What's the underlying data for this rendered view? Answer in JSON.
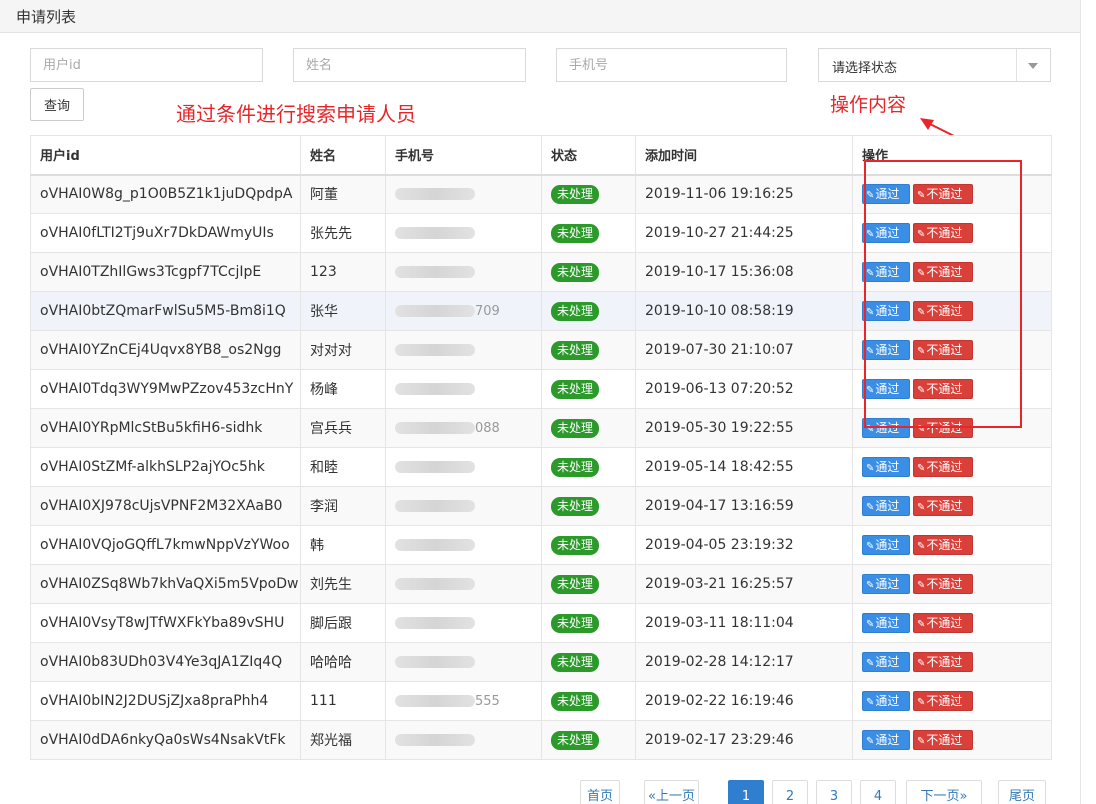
{
  "panel": {
    "title": "申请列表"
  },
  "filters": {
    "user_id_placeholder": "用户id",
    "name_placeholder": "姓名",
    "phone_placeholder": "手机号",
    "status_select_value": "请选择状态",
    "query_label": "查询"
  },
  "annotations": {
    "search_note": "通过条件进行搜索申请人员",
    "ops_note": "操作内容"
  },
  "table": {
    "headers": [
      "用户id",
      "姓名",
      "手机号",
      "状态",
      "添加时间",
      "操作"
    ],
    "pass_label": "通过",
    "reject_label": "不通过",
    "rows": [
      {
        "uid": "oVHAI0W8g_p1O0B5Z1k1juDQpdpA",
        "name": "阿董",
        "phone_tail": "",
        "status": "未处理",
        "time": "2019-11-06 19:16:25"
      },
      {
        "uid": "oVHAI0fLTI2Tj9uXr7DkDAWmyUIs",
        "name": "张先先",
        "phone_tail": "",
        "status": "未处理",
        "time": "2019-10-27 21:44:25"
      },
      {
        "uid": "oVHAI0TZhIlGws3Tcgpf7TCcjIpE",
        "name": "123",
        "phone_tail": "",
        "status": "未处理",
        "time": "2019-10-17 15:36:08"
      },
      {
        "uid": "oVHAI0btZQmarFwlSu5M5-Bm8i1Q",
        "name": "张华",
        "phone_tail": "709",
        "status": "未处理",
        "time": "2019-10-10 08:58:19"
      },
      {
        "uid": "oVHAI0YZnCEj4Uqvx8YB8_os2Ngg",
        "name": "对对对",
        "phone_tail": "",
        "status": "未处理",
        "time": "2019-07-30 21:10:07"
      },
      {
        "uid": "oVHAI0Tdq3WY9MwPZzov453zcHnY",
        "name": "杨峰",
        "phone_tail": "",
        "status": "未处理",
        "time": "2019-06-13 07:20:52"
      },
      {
        "uid": "oVHAI0YRpMlcStBu5kfiH6-sidhk",
        "name": "宫兵兵",
        "phone_tail": "088",
        "status": "未处理",
        "time": "2019-05-30 19:22:55"
      },
      {
        "uid": "oVHAI0StZMf-alkhSLP2ajYOc5hk",
        "name": "和睦",
        "phone_tail": "",
        "status": "未处理",
        "time": "2019-05-14 18:42:55"
      },
      {
        "uid": "oVHAI0XJ978cUjsVPNF2M32XAaB0",
        "name": "李润",
        "phone_tail": "",
        "status": "未处理",
        "time": "2019-04-17 13:16:59"
      },
      {
        "uid": "oVHAI0VQjoGQffL7kmwNppVzYWoo",
        "name": "韩",
        "phone_tail": "",
        "status": "未处理",
        "time": "2019-04-05 23:19:32"
      },
      {
        "uid": "oVHAI0ZSq8Wb7khVaQXi5m5VpoDw",
        "name": "刘先生",
        "phone_tail": "",
        "status": "未处理",
        "time": "2019-03-21 16:25:57"
      },
      {
        "uid": "oVHAI0VsyT8wJTfWXFkYba89vSHU",
        "name": "脚后跟",
        "phone_tail": "",
        "status": "未处理",
        "time": "2019-03-11 18:11:04"
      },
      {
        "uid": "oVHAI0b83UDh03V4Ye3qJA1ZIq4Q",
        "name": "哈哈哈",
        "phone_tail": "",
        "status": "未处理",
        "time": "2019-02-28 14:12:17"
      },
      {
        "uid": "oVHAI0bIN2J2DUSjZJxa8praPhh4",
        "name": "111",
        "phone_tail": "555",
        "status": "未处理",
        "time": "2019-02-22 16:19:46"
      },
      {
        "uid": "oVHAI0dDA6nkyQa0sWs4NsakVtFk",
        "name": "郑光福",
        "phone_tail": "",
        "status": "未处理",
        "time": "2019-02-17 23:29:46"
      }
    ]
  },
  "pagination": {
    "first": "首页",
    "prev": "«上一页",
    "pages": [
      "1",
      "2",
      "3",
      "4"
    ],
    "current": "1",
    "next": "下一页»",
    "last": "尾页"
  },
  "colors": {
    "accent_blue": "#3a8ee6",
    "reject_red": "#d9403a",
    "status_green": "#2b9a2b",
    "annotation_red": "#e8262a"
  }
}
